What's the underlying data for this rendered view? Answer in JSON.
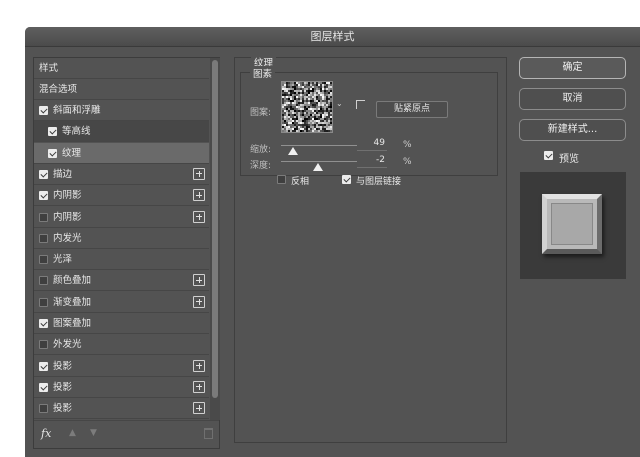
{
  "dialog": {
    "title": "图层样式"
  },
  "style_list": {
    "header": "样式",
    "blend_options": "混合选项",
    "items": [
      {
        "label": "斜面和浮雕",
        "checked": true,
        "plus": false,
        "indent": false
      },
      {
        "label": "等高线",
        "checked": true,
        "plus": false,
        "indent": true
      },
      {
        "label": "纹理",
        "checked": true,
        "plus": false,
        "indent": true,
        "selected": true
      },
      {
        "label": "描边",
        "checked": true,
        "plus": true,
        "indent": false
      },
      {
        "label": "内阴影",
        "checked": true,
        "plus": true,
        "indent": false
      },
      {
        "label": "内阴影",
        "checked": false,
        "plus": true,
        "indent": false
      },
      {
        "label": "内发光",
        "checked": false,
        "plus": false,
        "indent": false
      },
      {
        "label": "光泽",
        "checked": false,
        "plus": false,
        "indent": false
      },
      {
        "label": "颜色叠加",
        "checked": false,
        "plus": true,
        "indent": false
      },
      {
        "label": "渐变叠加",
        "checked": false,
        "plus": true,
        "indent": false
      },
      {
        "label": "图案叠加",
        "checked": true,
        "plus": false,
        "indent": false
      },
      {
        "label": "外发光",
        "checked": false,
        "plus": false,
        "indent": false
      },
      {
        "label": "投影",
        "checked": true,
        "plus": true,
        "indent": false
      },
      {
        "label": "投影",
        "checked": true,
        "plus": true,
        "indent": false
      },
      {
        "label": "投影",
        "checked": false,
        "plus": true,
        "indent": false
      }
    ],
    "footer": {
      "fx_label": "fx",
      "up_icon": "▲",
      "down_icon": "▼"
    }
  },
  "texture": {
    "section_title": "纹理",
    "group_title": "图素",
    "pattern_label": "图案:",
    "snap_button": "贴紧原点",
    "scale_label": "缩放:",
    "scale_value": "49",
    "scale_unit": "%",
    "scale_fraction": 0.16,
    "depth_label": "深度:",
    "depth_value": "-2",
    "depth_unit": "%",
    "depth_fraction": 0.49,
    "invert_label": "反相",
    "invert_checked": false,
    "link_label": "与图层链接",
    "link_checked": true,
    "dropdown_icon": "⌄"
  },
  "actions": {
    "ok": "确定",
    "cancel": "取消",
    "new_style": "新建样式...",
    "preview_label": "预览",
    "preview_checked": true
  }
}
